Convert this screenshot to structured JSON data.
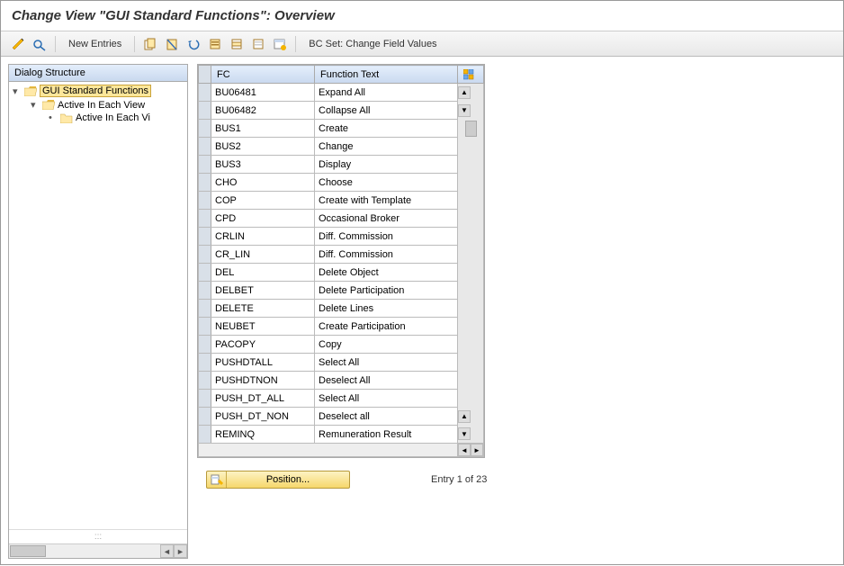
{
  "title": "Change View \"GUI Standard Functions\": Overview",
  "toolbar": {
    "new_entries": "New Entries",
    "bc_set": "BC Set: Change Field Values"
  },
  "tree": {
    "header": "Dialog Structure",
    "nodes": [
      {
        "label": "GUI Standard Functions",
        "level": 1,
        "open": true,
        "selected": true
      },
      {
        "label": "Active In Each View",
        "level": 2,
        "open": true,
        "selected": false
      },
      {
        "label": "Active In Each Vi",
        "level": 3,
        "open": false,
        "selected": false
      }
    ]
  },
  "table": {
    "columns": [
      "FC",
      "Function Text"
    ],
    "rows": [
      {
        "fc": "BU06481",
        "ft": "Expand All"
      },
      {
        "fc": "BU06482",
        "ft": "Collapse All"
      },
      {
        "fc": "BUS1",
        "ft": "Create"
      },
      {
        "fc": "BUS2",
        "ft": "Change"
      },
      {
        "fc": "BUS3",
        "ft": "Display"
      },
      {
        "fc": "CHO",
        "ft": "Choose"
      },
      {
        "fc": "COP",
        "ft": "Create with Template"
      },
      {
        "fc": "CPD",
        "ft": "Occasional Broker"
      },
      {
        "fc": "CRLIN",
        "ft": " Diff. Commission"
      },
      {
        "fc": "CR_LIN",
        "ft": " Diff. Commission"
      },
      {
        "fc": "DEL",
        "ft": "Delete Object"
      },
      {
        "fc": "DELBET",
        "ft": "Delete Participation"
      },
      {
        "fc": "DELETE",
        "ft": "Delete Lines"
      },
      {
        "fc": "NEUBET",
        "ft": "Create Participation"
      },
      {
        "fc": "PACOPY",
        "ft": "Copy"
      },
      {
        "fc": "PUSHDTALL",
        "ft": "Select All"
      },
      {
        "fc": "PUSHDTNON",
        "ft": "Deselect All"
      },
      {
        "fc": "PUSH_DT_ALL",
        "ft": "Select All"
      },
      {
        "fc": "PUSH_DT_NON",
        "ft": "Deselect all"
      },
      {
        "fc": "REMINQ",
        "ft": "Remuneration Result"
      }
    ]
  },
  "footer": {
    "position_label": "Position...",
    "entry_text": "Entry 1 of 23"
  }
}
